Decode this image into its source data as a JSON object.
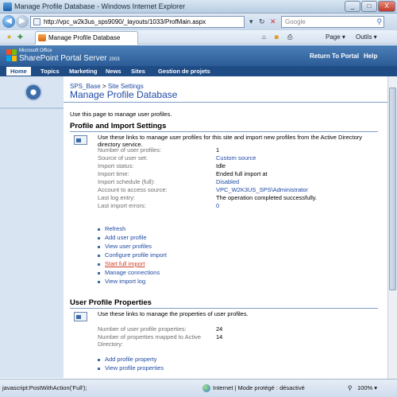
{
  "window": {
    "title": "Manage Profile Database - Windows Internet Explorer",
    "minimize": "_",
    "maximize": "□",
    "close": "X"
  },
  "addressbar": {
    "url": "http://vpc_w2k3us_sps9090/_layouts/1033/ProfMain.aspx",
    "search_placeholder": "Google",
    "refresh": "↻",
    "stop": "✕"
  },
  "tab": {
    "label": "Manage Profile Database",
    "page_menu": "Page",
    "tools_menu": "Outils"
  },
  "header": {
    "brand_top": "Microsoft Office",
    "brand_main": "SharePoint Portal Server",
    "brand_year": "2003",
    "return_link": "Return To Portal",
    "help_link": "Help"
  },
  "topnav": [
    "Home",
    "Topics",
    "Marketing",
    "News",
    "Sites",
    "Gestion de projets"
  ],
  "breadcrumb": {
    "root": "SPS_Base",
    "separator": ">",
    "current": "Site Settings"
  },
  "page": {
    "title": "Manage Profile Database",
    "intro": "Use this page to manage user profiles."
  },
  "profile_section": {
    "title": "Profile and Import Settings",
    "description": "Use these links to manage user profiles for this site and import new profiles from the Active Directory directory service.",
    "rows": [
      {
        "label": "Number of user profiles:",
        "value": "1",
        "link": false
      },
      {
        "label": "Source of user set:",
        "value": "Custom source",
        "link": true
      },
      {
        "label": "Import status:",
        "value": "Idle",
        "link": false
      },
      {
        "label": "Import time:",
        "value": "Ended full import at",
        "link": false
      },
      {
        "label": "Import schedule (full):",
        "value": "Disabled",
        "link": true
      },
      {
        "label": "Account to access source:",
        "value": "VPC_W2K3US_SPS\\Administrator",
        "link": true
      },
      {
        "label": "Last log entry:",
        "value": "The operation completed successfully.",
        "link": false
      },
      {
        "label": "Last import errors:",
        "value": "0",
        "link": true
      }
    ],
    "actions": [
      "Refresh",
      "Add user profile",
      "View user profiles",
      "Configure profile import",
      "Start full import",
      "Manage connections",
      "View import log"
    ]
  },
  "properties_section": {
    "title": "User Profile Properties",
    "description": "Use these links to manage the properties of user profiles.",
    "rows": [
      {
        "label": "Number of user profile properties:",
        "value": "24"
      },
      {
        "label": "Number of properties mapped to Active Directory:",
        "value": "14"
      }
    ],
    "actions": [
      "Add profile property",
      "View profile properties"
    ]
  },
  "statusbar": {
    "text": "javascript:PostWithAction('Full');",
    "zone": "Internet | Mode protégé : désactivé",
    "zoom": "100%"
  }
}
